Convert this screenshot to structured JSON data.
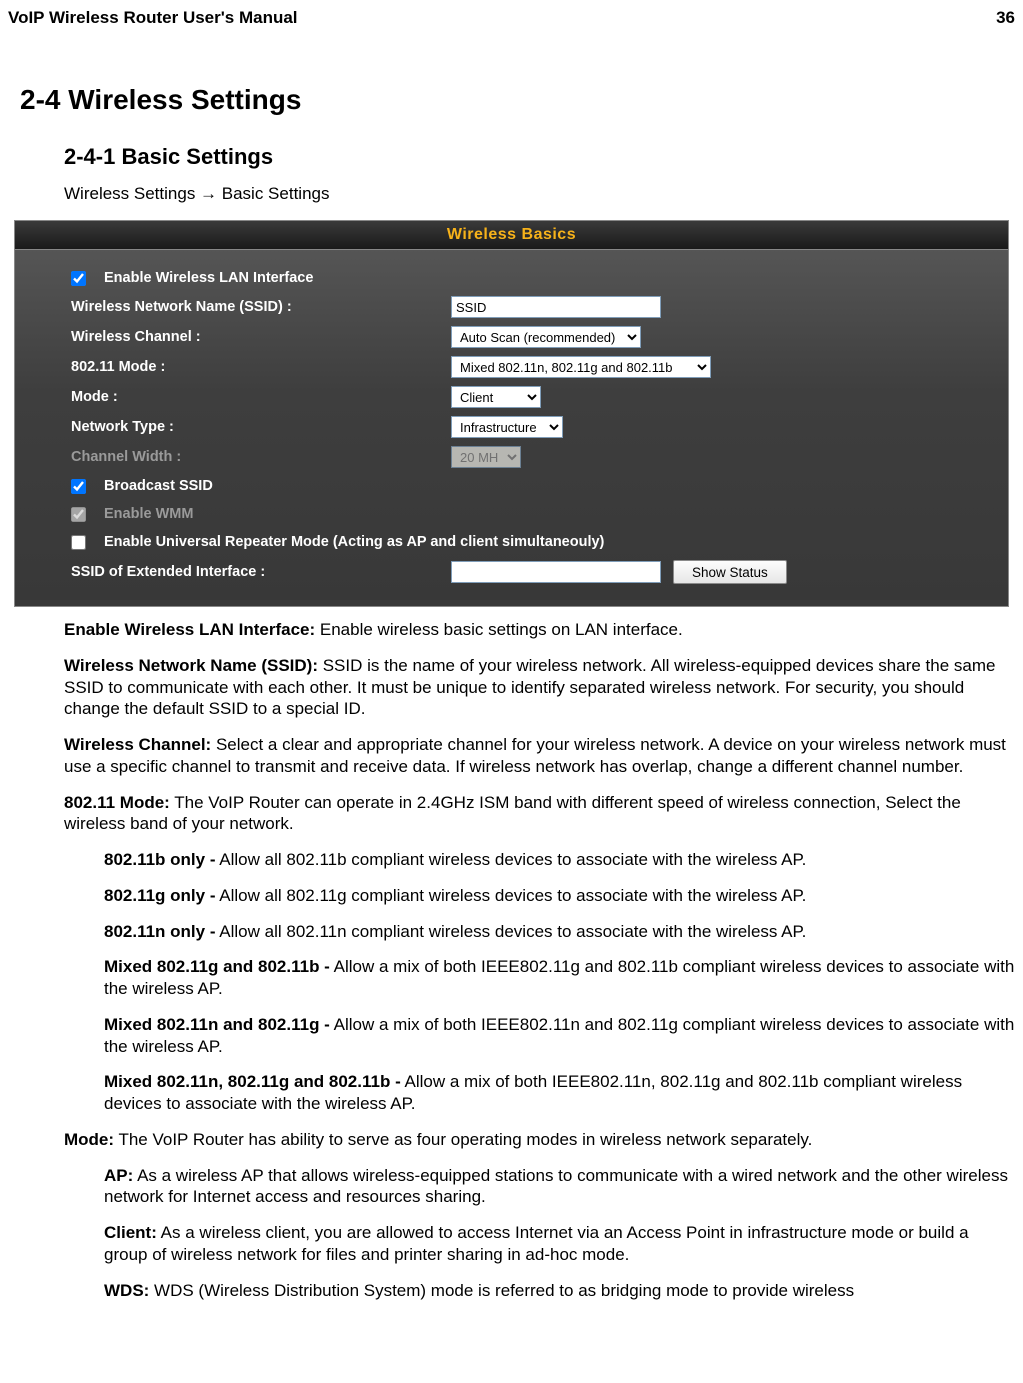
{
  "header": {
    "title": "VoIP Wireless Router User's Manual",
    "page_num": "36"
  },
  "section_h1": "2-4 Wireless Settings",
  "section_h2": "2-4-1 Basic Settings",
  "breadcrumb": "Wireless Settings  →  Basic Settings",
  "panel": {
    "title": "Wireless Basics",
    "labels": {
      "enable_wlan": "Enable Wireless LAN Interface",
      "ssid": "Wireless Network Name (SSID) :",
      "channel": "Wireless Channel :",
      "mode80211": "802.11 Mode :",
      "mode": "Mode :",
      "nettype": "Network Type :",
      "chwidth": "Channel Width :",
      "bcast": "Broadcast SSID",
      "wmm": "Enable WMM",
      "repeater": "Enable Universal Repeater Mode (Acting as AP and client simultaneouly)",
      "ext_ssid": "SSID of Extended Interface :",
      "show_status": "Show Status"
    },
    "values": {
      "ssid": "SSID",
      "channel": "Auto Scan (recommended)",
      "mode80211": "Mixed 802.11n, 802.11g and 802.11b",
      "mode": "Client",
      "nettype": "Infrastructure",
      "chwidth": "20 MH",
      "ext_ssid": ""
    },
    "checks": {
      "enable_wlan": true,
      "bcast": true,
      "wmm": true,
      "repeater": false
    }
  },
  "desc": {
    "enable_b": "Enable Wireless LAN Interface:",
    "enable_t": " Enable wireless basic settings on LAN interface.",
    "ssid_b": "Wireless Network Name (SSID):",
    "ssid_t": " SSID is the name of your wireless network. All wireless-equipped devices share the same SSID to communicate with each other. It must be unique to identify separated wireless network. For security, you should change the default SSID to a special ID.",
    "chan_b": "Wireless Channel:",
    "chan_t": " Select a clear and appropriate channel for your wireless network. A device on your wireless network must use a specific channel to transmit and receive data. If wireless network has overlap, change a different channel number.",
    "m80211_b": "802.11 Mode:",
    "m80211_t": " The VoIP Router can operate in 2.4GHz ISM band with different speed of wireless connection, Select the wireless band of your network.",
    "m1b": "802.11b only -",
    "m1t": " Allow all 802.11b compliant wireless devices to associate with the wireless AP.",
    "m2b": "802.11g only -",
    "m2t": " Allow all 802.11g compliant wireless devices to associate with the wireless AP.",
    "m3b": "802.11n only -",
    "m3t": " Allow all 802.11n compliant wireless devices to associate with the wireless AP.",
    "m4b": "Mixed 802.11g and 802.11b -",
    "m4t": " Allow a mix of both IEEE802.11g and 802.11b compliant wireless devices to associate with the wireless AP.",
    "m5b": "Mixed 802.11n and 802.11g -",
    "m5t": " Allow a mix of both IEEE802.11n and 802.11g compliant wireless devices to associate with the wireless AP.",
    "m6b": "Mixed 802.11n, 802.11g and 802.11b -",
    "m6t": " Allow a mix of both IEEE802.11n, 802.11g and 802.11b compliant wireless devices to associate with the wireless AP.",
    "mode_b": "Mode:",
    "mode_t": " The VoIP Router has ability to serve as four operating modes in wireless network separately.",
    "ap_b": "AP:",
    "ap_t": " As a wireless AP that allows wireless-equipped stations to communicate with a wired network and the other wireless network for Internet access and resources sharing.",
    "cl_b": "Client:",
    "cl_t": " As a wireless client, you are allowed to access Internet via an Access Point in infrastructure mode or build a group of wireless network for files and printer sharing in ad-hoc mode.",
    "wds_b": "WDS:",
    "wds_t": " WDS (Wireless Distribution System) mode is referred to as bridging mode to provide wireless"
  }
}
